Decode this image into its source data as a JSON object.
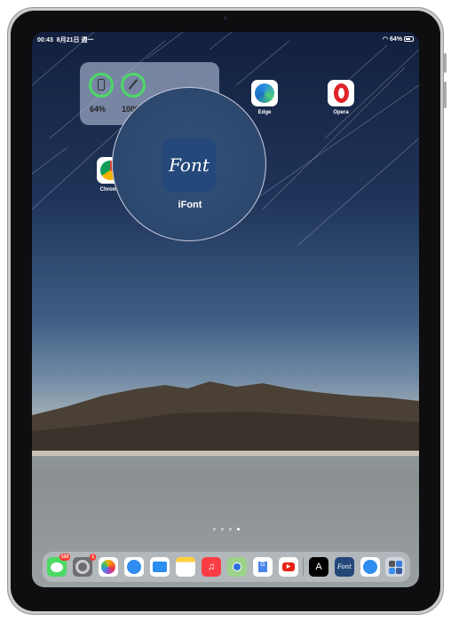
{
  "status": {
    "time": "00:43",
    "date": "8月21日 週一",
    "battery": "64%"
  },
  "widget": {
    "items": [
      {
        "icon": "ipad-icon",
        "value": "64%",
        "level": 64
      },
      {
        "icon": "pencil-icon",
        "value": "100%",
        "level": 100
      },
      {
        "icon": "empty"
      },
      {
        "icon": "empty"
      }
    ]
  },
  "apps": [
    {
      "label": "Edge"
    },
    {
      "label": "Opera"
    },
    {
      "label": "Chrome"
    }
  ],
  "magnified": {
    "label": "iFont",
    "glyph": "Font"
  },
  "page_dots": {
    "count": 4,
    "active": 4
  },
  "dock": {
    "items": [
      {
        "name": "messages",
        "badge": "109",
        "color": "#4cd964"
      },
      {
        "name": "settings",
        "badge": "1",
        "color": "#8e8e93"
      },
      {
        "name": "photos",
        "color": "#ffffff"
      },
      {
        "name": "safari",
        "color": "#ffffff"
      },
      {
        "name": "files",
        "color": "#ffffff"
      },
      {
        "name": "notes",
        "color": "#ffffff"
      },
      {
        "name": "music",
        "color": "#fc3c44"
      },
      {
        "name": "maps",
        "color": "#9bd38a"
      },
      {
        "name": "google-translate",
        "color": "#ffffff"
      },
      {
        "name": "youtube",
        "color": "#ffffff"
      },
      {
        "name": "font-app",
        "glyph": "A",
        "color": "#000000"
      },
      {
        "name": "ifont",
        "glyph": "Font",
        "color": "#24487a"
      },
      {
        "name": "safari-recent",
        "color": "#ffffff"
      },
      {
        "name": "app-library",
        "color": "#d0d6de"
      }
    ]
  }
}
